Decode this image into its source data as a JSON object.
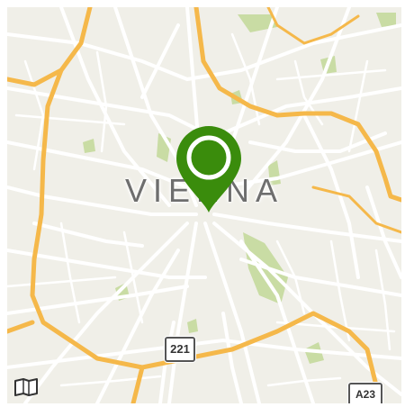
{
  "map": {
    "city_label": "VIENNA",
    "marker_color": "#3a8c0c",
    "road_major_color": "#f5b84a",
    "road_minor_color": "#ffffff",
    "park_color": "#c9dca4",
    "land_color": "#f0efe8"
  },
  "shields": {
    "route_221": "221",
    "route_a23": "A23"
  },
  "controls": {
    "map_type_icon": "map-book-icon"
  }
}
